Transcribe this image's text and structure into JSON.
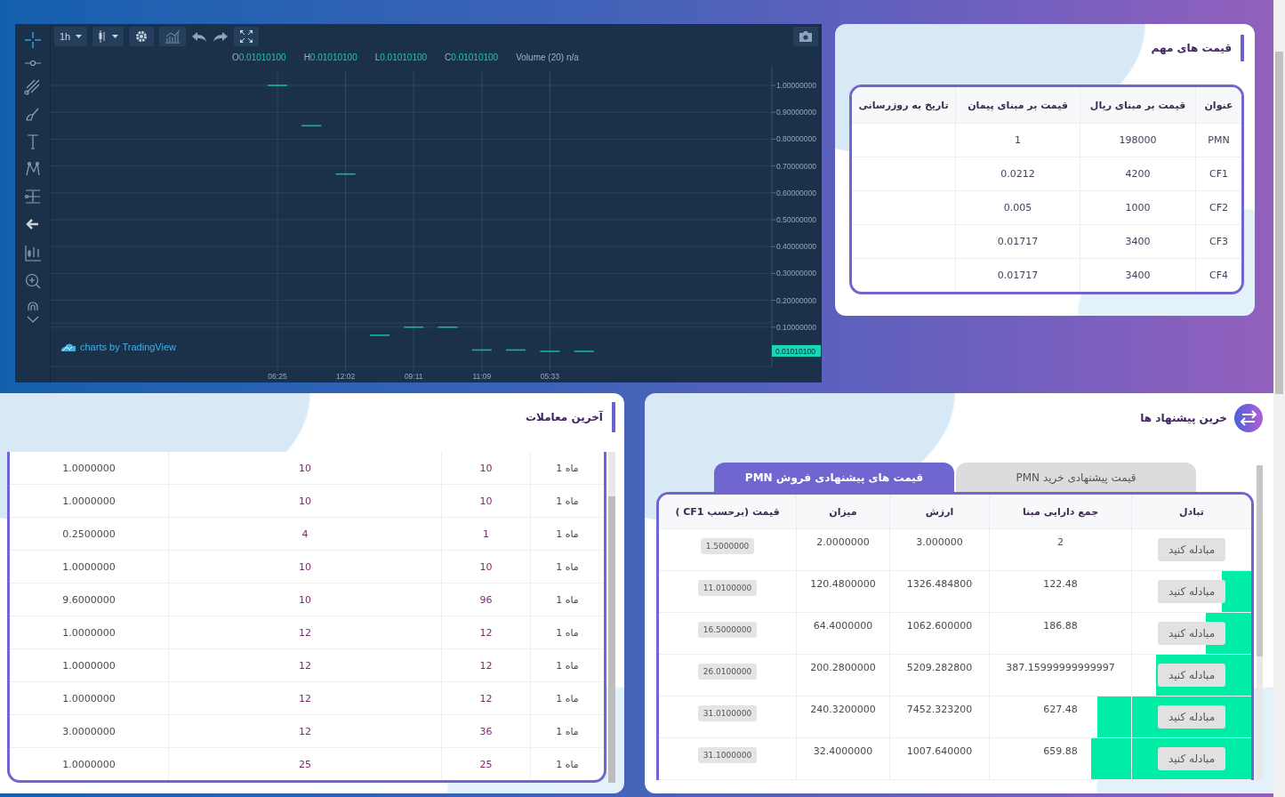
{
  "chart": {
    "interval": "1h",
    "legend": {
      "open": {
        "key": "O",
        "value": "0.01010100"
      },
      "high": {
        "key": "H",
        "value": "0.01010100"
      },
      "low": {
        "key": "L",
        "value": "0.01010100"
      },
      "close": {
        "key": "C",
        "value": "0.01010100"
      }
    },
    "volume": "Volume (20) n/a",
    "last_price": "0.01010100",
    "credit": "charts by TradingView",
    "time_axis": {
      "tick_1": "06:25",
      "tick_2": "12:02",
      "tick_3": "09:11",
      "tick_4": "11:09",
      "tick_5": "05:33"
    },
    "price_labels": [
      "1.00000000",
      "0.90000000",
      "0.80000000",
      "0.70000000",
      "0.60000000",
      "0.50000000",
      "0.40000000",
      "0.30000000",
      "0.20000000",
      "0.10000000"
    ]
  },
  "important_prices": {
    "title": "قیمت های مهم",
    "columns": [
      "عنوان",
      "قیمت بر مبنای ریال",
      "قیمت بر مبنای پیمان",
      "تاریخ به روزرسانی"
    ],
    "rows": [
      [
        "PMN",
        "198000",
        "1"
      ],
      [
        "CF1",
        "4200",
        "0.0212"
      ],
      [
        "CF2",
        "1000",
        "0.005"
      ],
      [
        "CF3",
        "3400",
        "0.01717"
      ],
      [
        "CF4",
        "3400",
        "0.01717"
      ]
    ]
  },
  "trades": {
    "title": "آخرین معاملات",
    "rows": [
      [
        "ماه 1",
        "10",
        "10",
        "1.0000000"
      ],
      [
        "ماه 1",
        "10",
        "10",
        "1.0000000"
      ],
      [
        "ماه 1",
        "1",
        "4",
        "0.2500000"
      ],
      [
        "ماه 1",
        "10",
        "10",
        "1.0000000"
      ],
      [
        "ماه 1",
        "96",
        "10",
        "9.6000000"
      ],
      [
        "ماه 1",
        "12",
        "12",
        "1.0000000"
      ],
      [
        "ماه 1",
        "12",
        "12",
        "1.0000000"
      ],
      [
        "ماه 1",
        "12",
        "12",
        "1.0000000"
      ],
      [
        "ماه 1",
        "36",
        "12",
        "3.0000000"
      ],
      [
        "ماه 1",
        "25",
        "25",
        "1.0000000"
      ]
    ]
  },
  "offers": {
    "title": "خرین پیشنهاد ها",
    "tabs": [
      {
        "label": "قیمت پیشنهادی خرید PMN",
        "selected": false
      },
      {
        "label": "قیمت های پیشنهادی فروش PMN",
        "selected": true
      }
    ],
    "columns": [
      "تبادل",
      "جمع دارایی مبنا",
      "ارزش",
      "میزان",
      "قیمت (برحسب CF1 )"
    ],
    "rows": [
      {
        "action": "مبادله کنید",
        "total": "2",
        "value": "3.000000",
        "amount": "2.0000000",
        "price": "1.5000000"
      },
      {
        "action": "مبادله کنید",
        "total": "122.48",
        "value": "1326.484800",
        "amount": "120.4800000",
        "price": "11.0100000",
        "level": 0.05
      },
      {
        "action": "مبادله کنید",
        "total": "186.88",
        "value": "1062.600000",
        "amount": "64.4000000",
        "price": "16.5000000",
        "level": 0.077
      },
      {
        "action": "مبادله کنید",
        "total": "387.15999999999997",
        "value": "5209.282800",
        "amount": "200.2800000",
        "price": "26.0100000",
        "level": 0.16
      },
      {
        "action": "مبادله کنید",
        "total": "627.48",
        "value": "7452.323200",
        "amount": "240.3200000",
        "price": "31.0100000",
        "level": 0.26
      },
      {
        "action": "مبادله کنید",
        "total": "659.88",
        "value": "1007.640000",
        "amount": "32.4000000",
        "price": "31.1000000",
        "level": 0.27
      }
    ]
  }
}
